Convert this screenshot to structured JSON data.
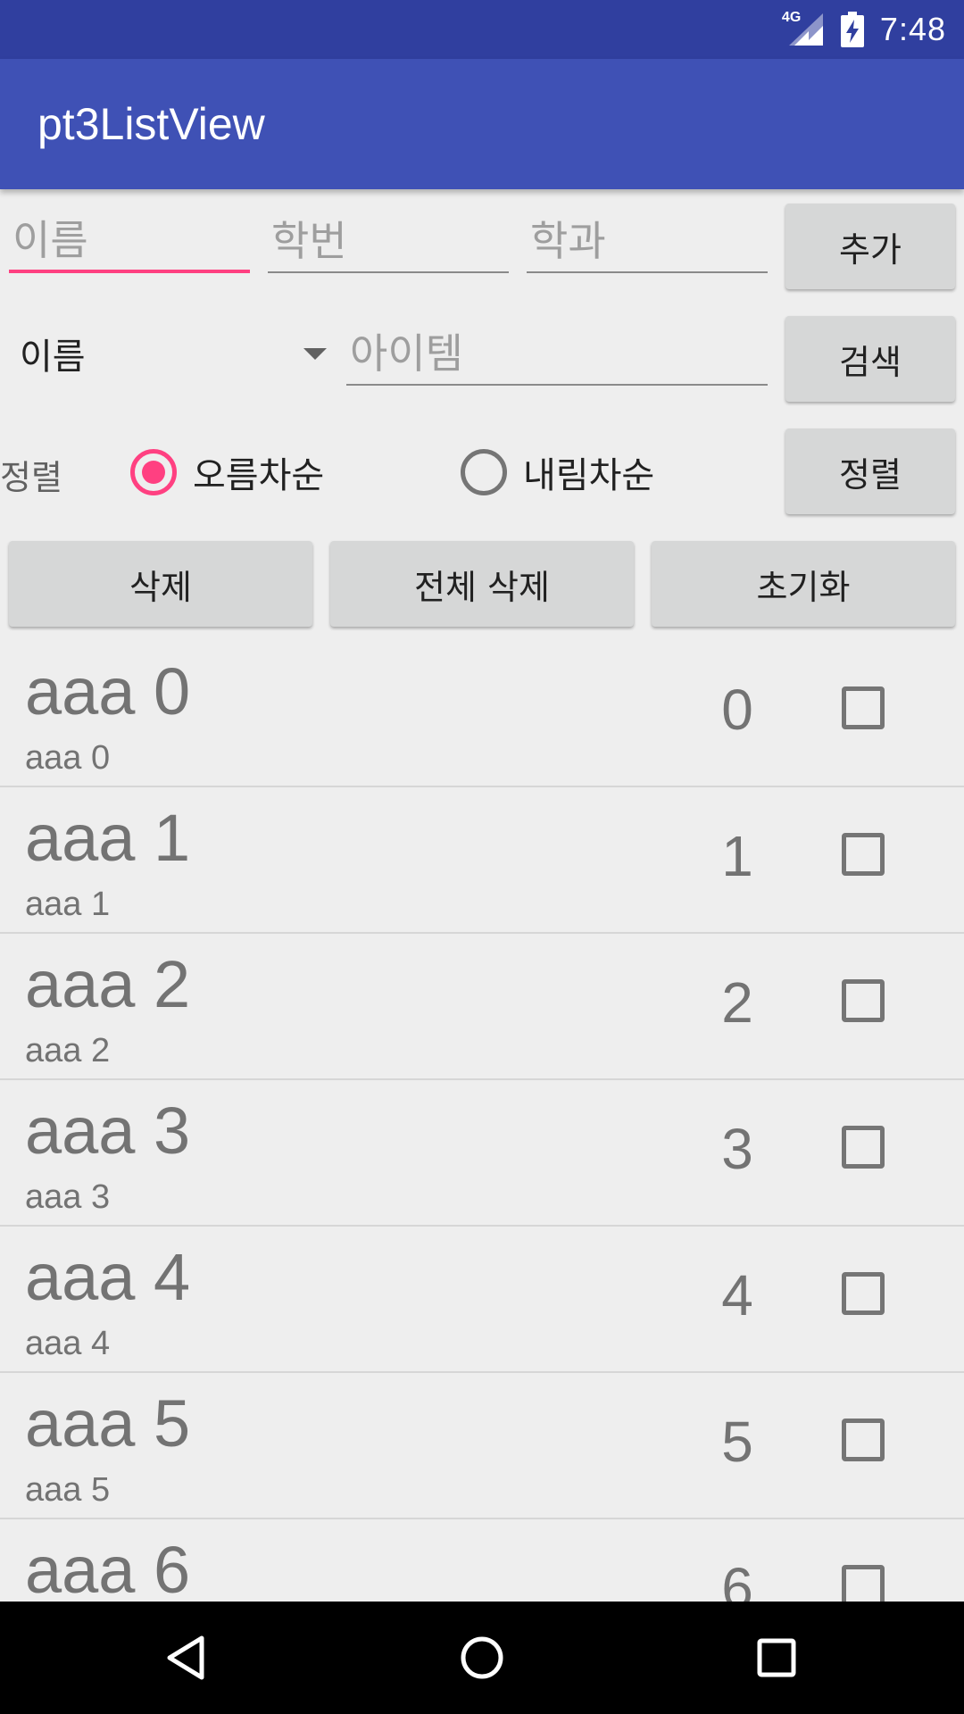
{
  "status_bar": {
    "network": "4G",
    "time": "7:48",
    "icons": [
      "signal-icon",
      "battery-charging-icon"
    ]
  },
  "app_bar": {
    "title": "pt3ListView"
  },
  "form": {
    "name_placeholder": "이름",
    "student_id_placeholder": "학번",
    "department_placeholder": "학과",
    "add_label": "추가",
    "search_field_value": "이름",
    "search_placeholder": "아이템",
    "search_label": "검색",
    "sort_label": "정렬",
    "ascending_label": "오름차순",
    "descending_label": "내림차순",
    "ascending_checked": true,
    "sort_button_label": "정렬",
    "delete_label": "삭제",
    "delete_all_label": "전체 삭제",
    "reset_label": "초기화"
  },
  "list": {
    "items": [
      {
        "title": "aaa 0",
        "subtitle": "aaa 0",
        "number": "0",
        "checked": false
      },
      {
        "title": "aaa 1",
        "subtitle": "aaa 1",
        "number": "1",
        "checked": false
      },
      {
        "title": "aaa 2",
        "subtitle": "aaa 2",
        "number": "2",
        "checked": false
      },
      {
        "title": "aaa 3",
        "subtitle": "aaa 3",
        "number": "3",
        "checked": false
      },
      {
        "title": "aaa 4",
        "subtitle": "aaa 4",
        "number": "4",
        "checked": false
      },
      {
        "title": "aaa 5",
        "subtitle": "aaa 5",
        "number": "5",
        "checked": false
      },
      {
        "title": "aaa 6",
        "subtitle": "",
        "number": "6",
        "checked": false
      }
    ]
  },
  "colors": {
    "status_bar": "#303f9f",
    "app_bar": "#3f51b5",
    "accent": "#ff4081",
    "background": "#eeeeee",
    "button": "#d6d7d7"
  },
  "nav_bar": {
    "icons": [
      "back-icon",
      "home-icon",
      "recents-icon"
    ]
  }
}
